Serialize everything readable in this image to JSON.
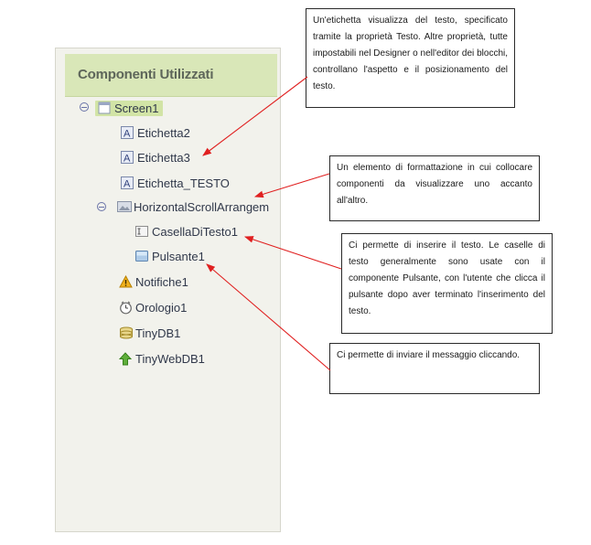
{
  "panel": {
    "title": "Componenti Utilizzati",
    "tree": [
      {
        "label": "Screen1",
        "icon": "screen-icon"
      },
      {
        "label": "Etichetta2",
        "icon": "label-icon"
      },
      {
        "label": "Etichetta3",
        "icon": "label-icon"
      },
      {
        "label": "Etichetta_TESTO",
        "icon": "label-icon"
      },
      {
        "label": "HorizontalScrollArrangem",
        "icon": "arrangement-icon"
      },
      {
        "label": "CasellaDiTesto1",
        "icon": "textbox-icon"
      },
      {
        "label": "Pulsante1",
        "icon": "button-icon"
      },
      {
        "label": "Notifiche1",
        "icon": "warning-icon"
      },
      {
        "label": "Orologio1",
        "icon": "clock-icon"
      },
      {
        "label": "TinyDB1",
        "icon": "database-icon"
      },
      {
        "label": "TinyWebDB1",
        "icon": "web-db-icon"
      }
    ]
  },
  "callouts": [
    {
      "text": "Un'etichetta visualizza del testo, specificato tramite la proprietà Testo. Altre proprietà, tutte impostabili nel Designer o nell'editor dei blocchi, controllano l'aspetto e il posizionamento del testo."
    },
    {
      "text": "Un elemento di formattazione in cui collocare componenti da visualizzare uno accanto all'altro."
    },
    {
      "text": "Ci permette di inserire il testo. Le caselle di testo generalmente sono usate con il componente Pulsante, con l'utente che clicca il pulsante dopo aver terminato l'inserimento del testo."
    },
    {
      "text": "Ci permette di inviare il messaggio cliccando."
    }
  ],
  "colors": {
    "header": "#d9e7b8",
    "selected": "#d2e4a6",
    "arrow": "#e02020",
    "panel": "#f2f2ec"
  }
}
